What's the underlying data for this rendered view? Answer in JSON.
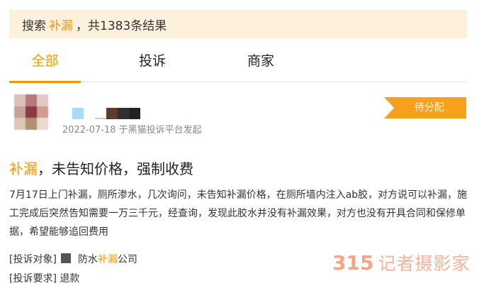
{
  "search": {
    "prefix": "搜索",
    "keyword": "补漏",
    "suffix": "，共1383条结果"
  },
  "tabs": [
    {
      "label": "全部",
      "active": true
    },
    {
      "label": "投诉",
      "active": false
    },
    {
      "label": "商家",
      "active": false
    }
  ],
  "complaint": {
    "meta": "2022-07-18 于黑猫投诉平台发起",
    "status_badge": "待分配",
    "title_keyword": "补漏",
    "title_rest": "，未告知价格，强制收费",
    "description": "7月17日上门补漏，厕所渗水，几次询问，未告知补漏价格，在厕所墙内注入ab胶，对方说可以补漏，施工完成后突然告知需要一万三千元，经查询，发现此胶水并没有补漏效果，对方也没有开具合同和保修单据，希望能够追回费用",
    "target_label": "[投诉对象]",
    "target_pre": "防水",
    "target_keyword": "补漏",
    "target_post": "公司",
    "demand_label": "[投诉要求]",
    "demand_value": "退款"
  },
  "watermark": {
    "number": "315",
    "text": "记者摄影家"
  },
  "colors": {
    "accent": "#f39800",
    "search_bg": "#fdf0dc",
    "badge": "#f6a11c"
  }
}
